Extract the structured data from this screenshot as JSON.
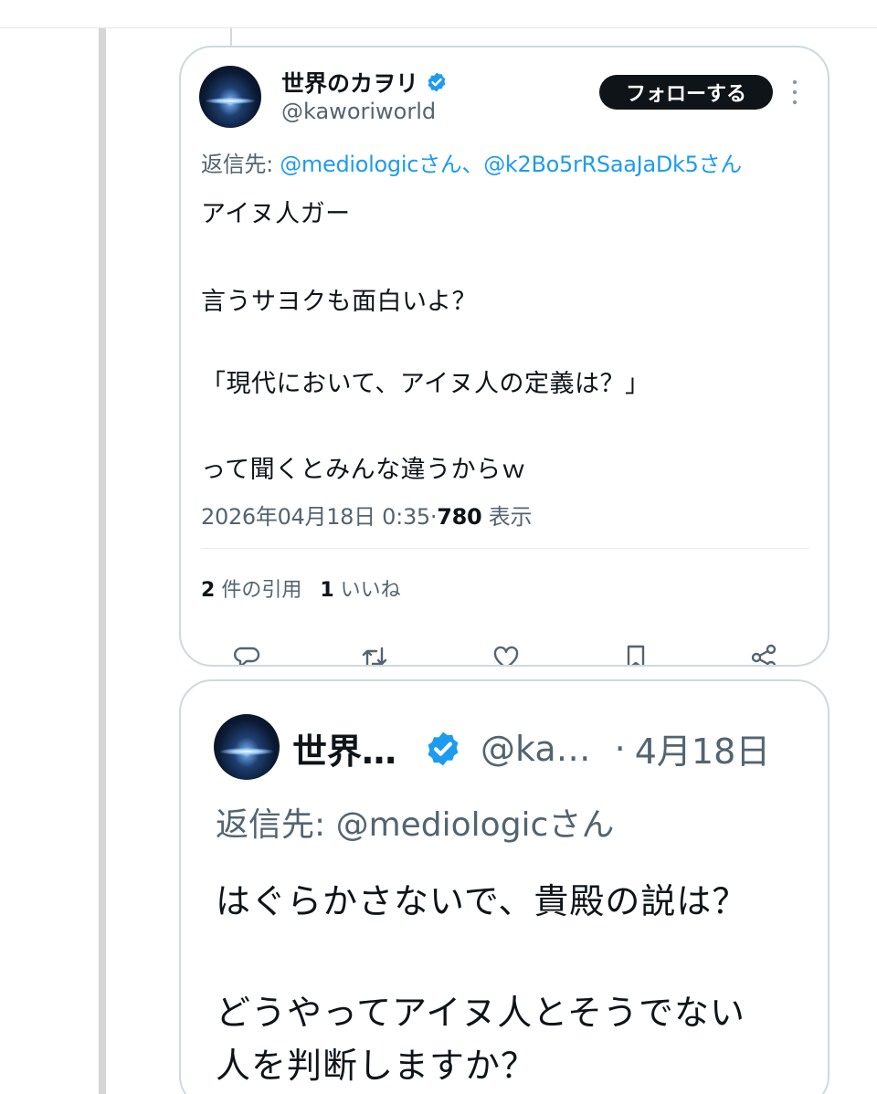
{
  "quoted_tweet": {
    "author_name": "世界のカヲリ",
    "handle": "@kaworiworld",
    "follow_label": "フォローする",
    "reply_to_prefix": "返信先: ",
    "reply_to_mentions": "@mediologicさん、@k2Bo5rRSaaJaDk5さん",
    "body_lines": [
      "アイヌ人ガー",
      "言うサヨクも面白いよ？",
      "「現代において、アイヌ人の定義は？」",
      "って聞くとみんな違うからｗ"
    ],
    "timestamp": "2026年04月18日 0:35",
    "dot": "·",
    "view_count": "780",
    "view_label": "表示",
    "quote_count": "2",
    "quote_label": "件の引用",
    "like_count": "1",
    "like_label": "いいね",
    "actions": [
      "reply-icon",
      "retweet-icon",
      "heart-icon",
      "bookmark-icon",
      "share-icon"
    ]
  },
  "reply_tweet": {
    "author_name": "世界…",
    "handle": "@ka…",
    "separator": "·",
    "date": "4月18日",
    "reply_to": "返信先: @mediologicさん",
    "body_lines": [
      "はぐらかさないで、貴殿の説は？",
      "どうやってアイヌ人とそうでない",
      "人を判断しますか？"
    ]
  },
  "colors": {
    "accent": "#1d9bf0",
    "text": "#0f1419",
    "muted": "#536471",
    "border": "#cfd9de"
  }
}
